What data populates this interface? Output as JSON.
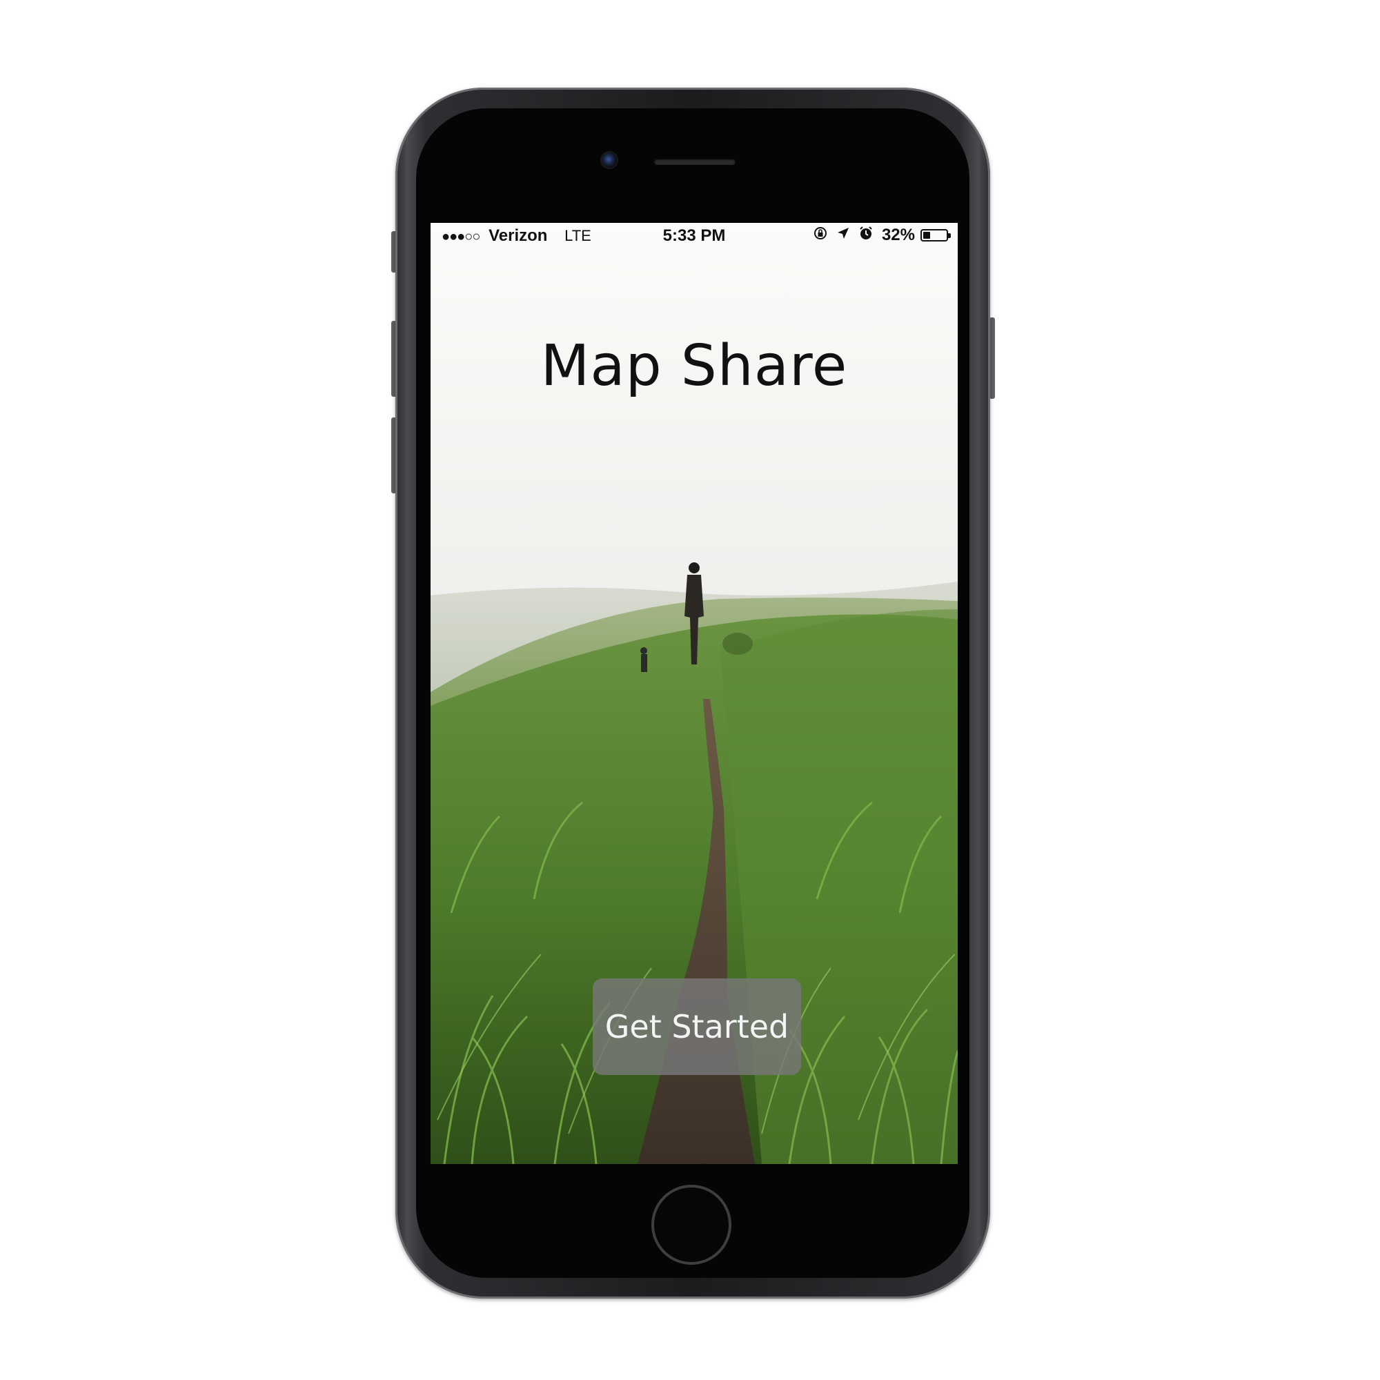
{
  "status_bar": {
    "signal": "●●●○○",
    "carrier": "Verizon",
    "network": "LTE",
    "time": "5:33 PM",
    "icons": [
      "rotation-lock-icon",
      "location-arrow-icon",
      "alarm-clock-icon"
    ],
    "battery_percent": "32%",
    "battery_level": 0.32
  },
  "app": {
    "title": "Map Share",
    "get_started_label": "Get Started"
  },
  "background": {
    "description_icon": "foggy-grass-hill-photo",
    "colors": {
      "fog": "#f3f3f1",
      "hill_far": "#a9b696",
      "grass": "#5f8a3a",
      "grass_dark": "#3f6a22",
      "path": "#4a3d32"
    }
  },
  "device": {
    "body_color": "#1c1c1e"
  }
}
